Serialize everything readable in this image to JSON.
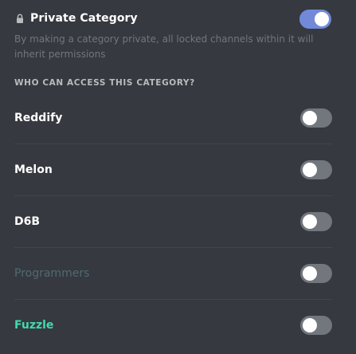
{
  "private_category": {
    "title": "Private Category",
    "lock_icon": "lock-icon",
    "enabled": true,
    "description": "By making a category private, all locked channels within it will inherit permissions"
  },
  "access_section": {
    "heading": "WHO CAN ACCESS THIS CATEGORY?"
  },
  "roles": [
    {
      "name": "Reddify",
      "color": "#ffffff",
      "enabled": false
    },
    {
      "name": "Melon",
      "color": "#ffffff",
      "enabled": false
    },
    {
      "name": "D6B",
      "color": "#ffffff",
      "enabled": false
    },
    {
      "name": "Programmers",
      "color": "#4f6a73",
      "enabled": false
    },
    {
      "name": "Fuzzle",
      "color": "#43d9ad",
      "enabled": false
    }
  ],
  "colors": {
    "background": "#36393f",
    "toggle_on": "#7289da",
    "toggle_off": "#72767d"
  }
}
